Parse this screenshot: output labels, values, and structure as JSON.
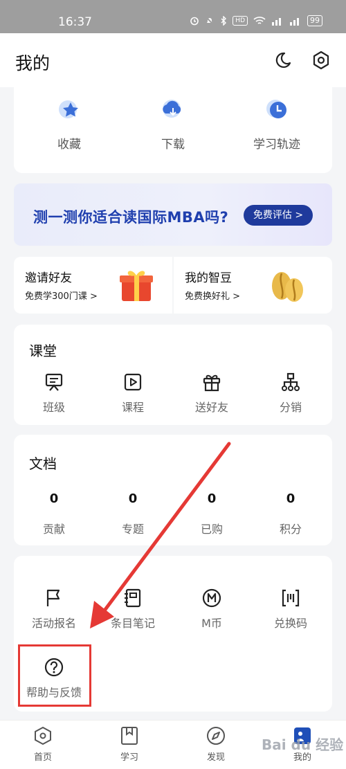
{
  "status_bar": {
    "time": "16:37",
    "icons": [
      "alarm-icon",
      "mute-icon",
      "bluetooth-icon",
      "hd-icon",
      "wifi-icon",
      "signal-icon",
      "signal-icon"
    ],
    "hd": "HD",
    "battery": "99"
  },
  "header": {
    "title": "我的",
    "icons": [
      "moon-icon",
      "settings-icon"
    ]
  },
  "quick": [
    {
      "label": "收藏",
      "icon": "star-icon"
    },
    {
      "label": "下载",
      "icon": "download-icon"
    },
    {
      "label": "学习轨迹",
      "icon": "clock-icon"
    }
  ],
  "banner": {
    "text": "测一测你适合读国际MBA吗?",
    "button": "免费评估 >"
  },
  "promos": [
    {
      "title": "邀请好友",
      "subtitle": "免费学300门课 >",
      "icon": "gift-icon"
    },
    {
      "title": "我的智豆",
      "subtitle": "免费换好礼 >",
      "icon": "beans-icon"
    }
  ],
  "classroom": {
    "title": "课堂",
    "items": [
      {
        "label": "班级",
        "icon": "class-icon"
      },
      {
        "label": "课程",
        "icon": "course-play-icon"
      },
      {
        "label": "送好友",
        "icon": "gift-icon"
      },
      {
        "label": "分销",
        "icon": "distribution-icon"
      }
    ]
  },
  "documents": {
    "title": "文档",
    "stats": [
      {
        "value": "0",
        "label": "贡献"
      },
      {
        "value": "0",
        "label": "专题"
      },
      {
        "value": "0",
        "label": "已购"
      },
      {
        "value": "0",
        "label": "积分"
      }
    ]
  },
  "services": {
    "items": [
      {
        "label": "活动报名",
        "icon": "flag-icon"
      },
      {
        "label": "条目笔记",
        "icon": "notebook-icon"
      },
      {
        "label": "M币",
        "icon": "m-coin-icon"
      },
      {
        "label": "兑换码",
        "icon": "redeem-code-icon"
      },
      {
        "label": "帮助与反馈",
        "icon": "help-icon"
      }
    ]
  },
  "tabbar": {
    "tabs": [
      {
        "label": "首页",
        "icon": "home-icon"
      },
      {
        "label": "学习",
        "icon": "study-icon"
      },
      {
        "label": "发现",
        "icon": "compass-icon"
      },
      {
        "label": "我的",
        "icon": "profile-icon"
      }
    ]
  },
  "watermark": "Bai du 经验",
  "colors": {
    "accent": "#1f3a9c",
    "annotation": "#e53935",
    "icon_blue": "#3b6fd8"
  }
}
